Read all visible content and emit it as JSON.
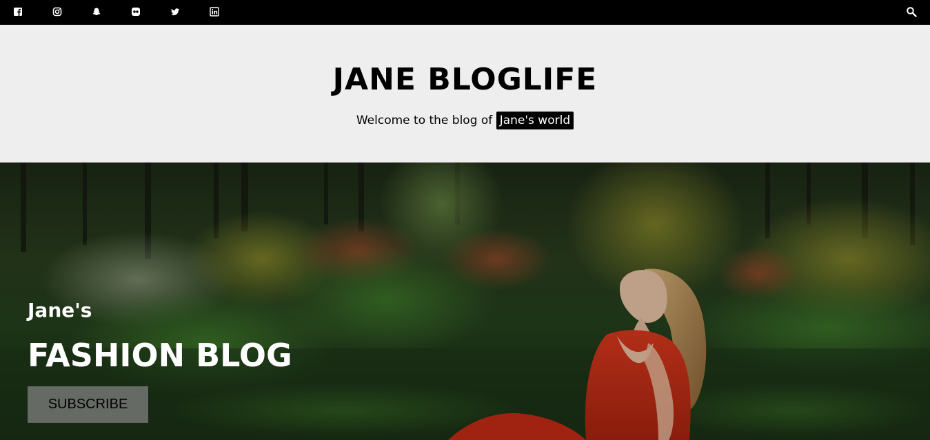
{
  "topbar": {
    "social_icons": [
      "facebook-icon",
      "instagram-icon",
      "snapchat-icon",
      "flickr-icon",
      "twitter-icon",
      "linkedin-icon"
    ],
    "search_icon": "search-icon"
  },
  "header": {
    "title": "JANE BLOGLIFE",
    "tagline_prefix": "Welcome to the blog of",
    "tagline_highlight": "Jane's world"
  },
  "hero": {
    "kicker": "Jane's",
    "title": "FASHION BLOG",
    "subscribe_label": "SUBSCRIBE"
  },
  "colors": {
    "topbar_bg": "#000000",
    "header_bg": "#eeeeee",
    "highlight_bg": "#000000",
    "button_bg": "#808080"
  }
}
